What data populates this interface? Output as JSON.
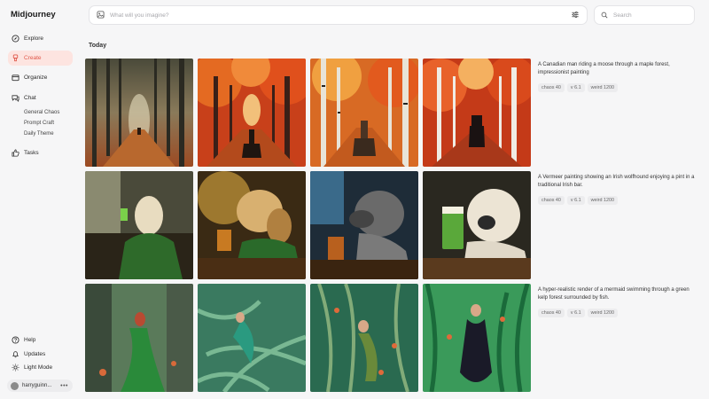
{
  "app": {
    "name": "Midjourney"
  },
  "sidebar": {
    "items": [
      {
        "label": "Explore",
        "icon": "compass-icon"
      },
      {
        "label": "Create",
        "icon": "brush-icon",
        "active": true
      },
      {
        "label": "Organize",
        "icon": "folder-icon"
      },
      {
        "label": "Chat",
        "icon": "chat-icon"
      }
    ],
    "chat_rooms": [
      "General Chaos",
      "Prompt Craft",
      "Daily Theme"
    ],
    "tasks": {
      "label": "Tasks",
      "icon": "thumbs-up-icon"
    },
    "bottom": [
      {
        "label": "Help",
        "icon": "help-icon"
      },
      {
        "label": "Updates",
        "icon": "bell-icon"
      },
      {
        "label": "Light Mode",
        "icon": "sun-icon"
      }
    ],
    "user": {
      "name": "harryguinn..."
    }
  },
  "imagine": {
    "placeholder": "What will you imagine?"
  },
  "search": {
    "placeholder": "Search"
  },
  "section": {
    "title": "Today"
  },
  "jobs": [
    {
      "prompt": "A Canadian man riding a moose through a maple forest, impressionist painting",
      "params": [
        "chaos 40",
        "v 6.1",
        "weird 1200"
      ],
      "theme": "forest"
    },
    {
      "prompt": "A Vermeer painting showing an Irish wolfhound enjoying a pint in a traditional Irish bar.",
      "params": [
        "chaos 40",
        "v 6.1",
        "weird 1200"
      ],
      "theme": "dog"
    },
    {
      "prompt": "A hyper-realistic render of a mermaid swimming through a green kelp forest surrounded by fish.",
      "params": [
        "chaos 40",
        "v 6.1",
        "weird 1200"
      ],
      "theme": "mermaid"
    }
  ],
  "colors": {
    "accent": "#e0584a",
    "active_bg": "#fde4e0"
  }
}
